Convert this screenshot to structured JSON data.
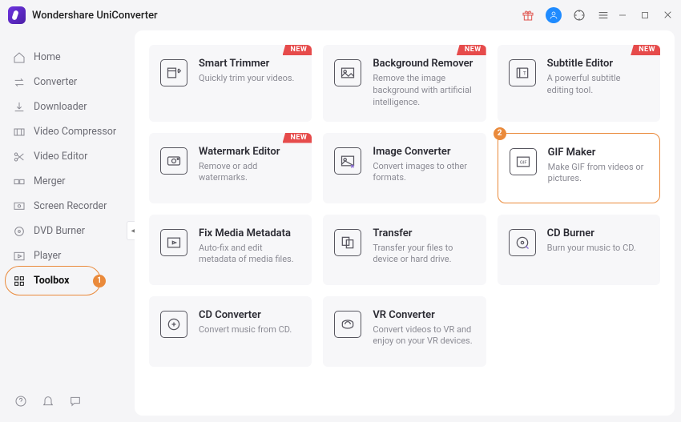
{
  "app_title": "Wondershare UniConverter",
  "annotations": {
    "sidebar": "1",
    "highlight": "2"
  },
  "sidebar": {
    "items": [
      {
        "label": "Home"
      },
      {
        "label": "Converter"
      },
      {
        "label": "Downloader"
      },
      {
        "label": "Video Compressor"
      },
      {
        "label": "Video Editor"
      },
      {
        "label": "Merger"
      },
      {
        "label": "Screen Recorder"
      },
      {
        "label": "DVD Burner"
      },
      {
        "label": "Player"
      },
      {
        "label": "Toolbox"
      }
    ]
  },
  "badge_text": "NEW",
  "tools": [
    {
      "title": "Smart Trimmer",
      "desc": "Quickly trim your videos.",
      "new": true
    },
    {
      "title": "Background Remover",
      "desc": "Remove the image background with artificial intelligence.",
      "new": true
    },
    {
      "title": "Subtitle Editor",
      "desc": "A powerful subtitle editing tool.",
      "new": true
    },
    {
      "title": "Watermark Editor",
      "desc": "Remove or add watermarks.",
      "new": true
    },
    {
      "title": "Image Converter",
      "desc": "Convert images to other formats."
    },
    {
      "title": "GIF Maker",
      "desc": "Make GIF from videos or pictures."
    },
    {
      "title": "Fix Media Metadata",
      "desc": "Auto-fix and edit metadata of media files."
    },
    {
      "title": "Transfer",
      "desc": "Transfer your files to device or hard drive."
    },
    {
      "title": "CD Burner",
      "desc": "Burn your music to CD."
    },
    {
      "title": "CD Converter",
      "desc": "Convert music from CD."
    },
    {
      "title": "VR Converter",
      "desc": "Convert videos to VR and enjoy on your VR devices."
    }
  ]
}
